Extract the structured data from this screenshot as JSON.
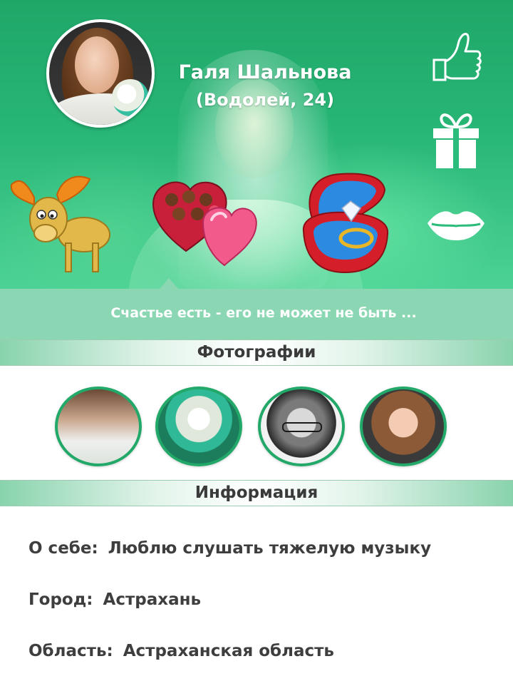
{
  "profile": {
    "name": "Галя Шальнова",
    "subtitle": "(Водолей, 24)",
    "status": "Счастье есть - его не может не быть ..."
  },
  "actions": {
    "like_icon": "thumbs-up-icon",
    "gift_icon": "gift-icon",
    "kiss_icon": "lips-icon"
  },
  "stickers": [
    "moose-sticker",
    "candy-heart-box-sticker",
    "ring-box-sticker"
  ],
  "sections": {
    "photos_title": "Фотографии",
    "info_title": "Информация"
  },
  "photos": [
    "photo-1",
    "photo-2",
    "photo-3",
    "photo-4"
  ],
  "info": [
    {
      "label": "О себе:",
      "value": "Люблю слушать тяжелую музыку"
    },
    {
      "label": "Город:",
      "value": "Астрахань"
    },
    {
      "label": "Область:",
      "value": "Астраханская область"
    }
  ],
  "colors": {
    "accent": "#22a868",
    "status_band": "#8cd7b3",
    "text": "#3e3e3e"
  }
}
